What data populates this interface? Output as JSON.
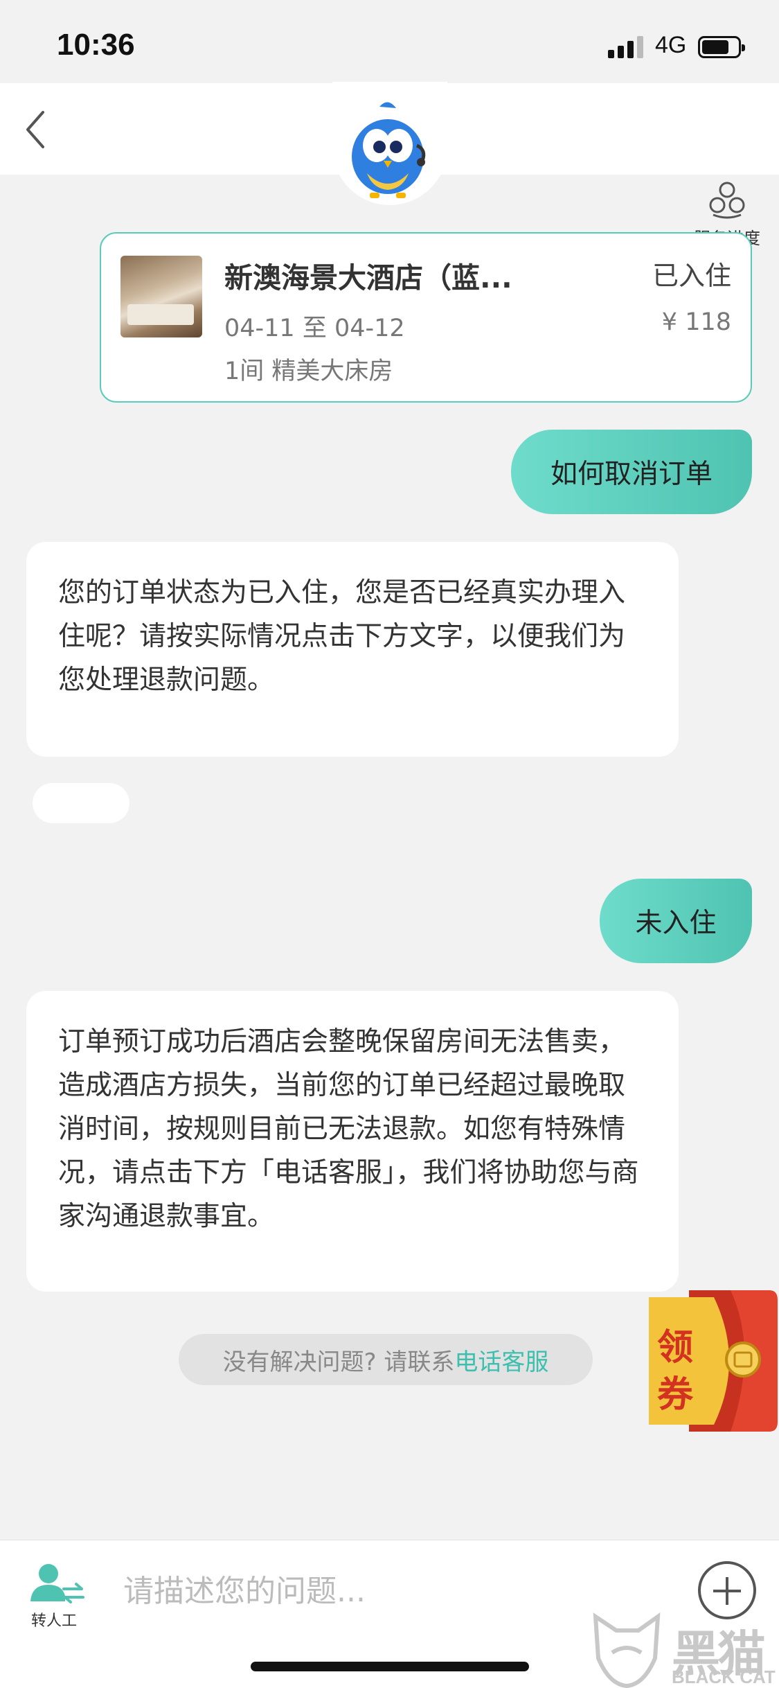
{
  "status_bar": {
    "time": "10:36",
    "network": "4G",
    "battery_level": 0.7,
    "signal_bars": 4
  },
  "header": {
    "service_progress_label": "服务进度"
  },
  "order_card": {
    "hotel_name": "新澳海景大酒店（蓝...",
    "status": "已入住",
    "dates": "04-11 至 04-12",
    "price": "¥ 118",
    "room": "1间 精美大床房"
  },
  "messages": [
    {
      "from": "user",
      "text": "如何取消订单"
    },
    {
      "from": "bot",
      "text": "您的订单状态为已入住，您是否已经真实办理入住呢？请按实际情况点击下方文字，以便我们为您处理退款问题。"
    },
    {
      "from": "user",
      "text": "未入住"
    },
    {
      "from": "bot",
      "text": "订单预订成功后酒店会整晚保留房间无法售卖，造成酒店方损失，当前您的订单已经超过最晚取消时间，按规则目前已无法退款。如您有特殊情况，请点击下方「电话客服」，我们将协助您与商家沟通退款事宜。"
    }
  ],
  "help": {
    "prompt": "没有解决问题? 请联系",
    "link": "电话客服"
  },
  "coupon": {
    "label_top": "领",
    "label_bottom": "券"
  },
  "footer": {
    "agent_label": "转人工",
    "input_placeholder": "请描述您的问题..."
  },
  "watermark": {
    "title": "黑猫",
    "subtitle": "BLACK CAT"
  },
  "colors": {
    "accent": "#4fc3b1",
    "link": "#3cbfae",
    "coupon_red": "#e2442f",
    "coupon_gold": "#f3c33b"
  }
}
